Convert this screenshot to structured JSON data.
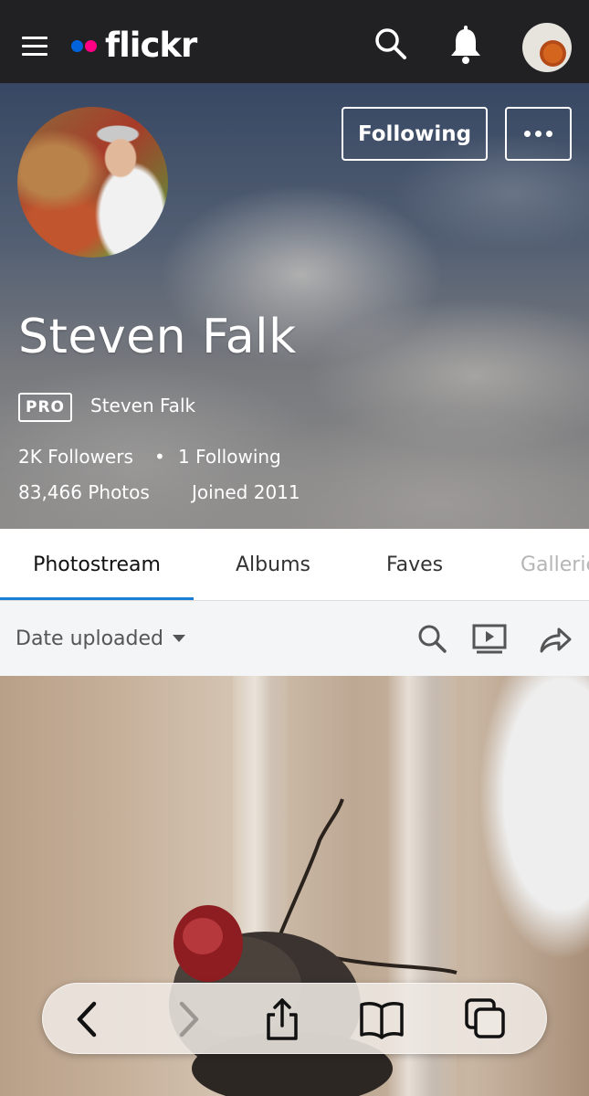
{
  "header": {
    "logo_text": "flickr",
    "brand_colors": {
      "blue": "#0063dc",
      "pink": "#ff0084"
    },
    "icons": [
      "menu-icon",
      "search-icon",
      "bell-icon",
      "avatar"
    ]
  },
  "profile": {
    "follow_button": "Following",
    "name": "Steven Falk",
    "pro_badge": "PRO",
    "real_name": "Steven Falk",
    "followers": "2K Followers",
    "separator": "•",
    "following": "1 Following",
    "photos": "83,466 Photos",
    "joined": "Joined 2011"
  },
  "tabs": [
    {
      "label": "Photostream",
      "active": true
    },
    {
      "label": "Albums",
      "active": false
    },
    {
      "label": "Faves",
      "active": false
    },
    {
      "label": "Galleries",
      "active": false
    }
  ],
  "toolbar": {
    "sort_label": "Date uploaded",
    "icons": [
      "search-icon",
      "slideshow-icon",
      "share-icon"
    ]
  },
  "browser_bar": {
    "icons": [
      "back-icon",
      "forward-icon",
      "share-icon",
      "bookmarks-icon",
      "tabs-icon"
    ]
  },
  "colors": {
    "topbar_bg": "#212124",
    "tab_active_underline": "#1a7fd4"
  }
}
